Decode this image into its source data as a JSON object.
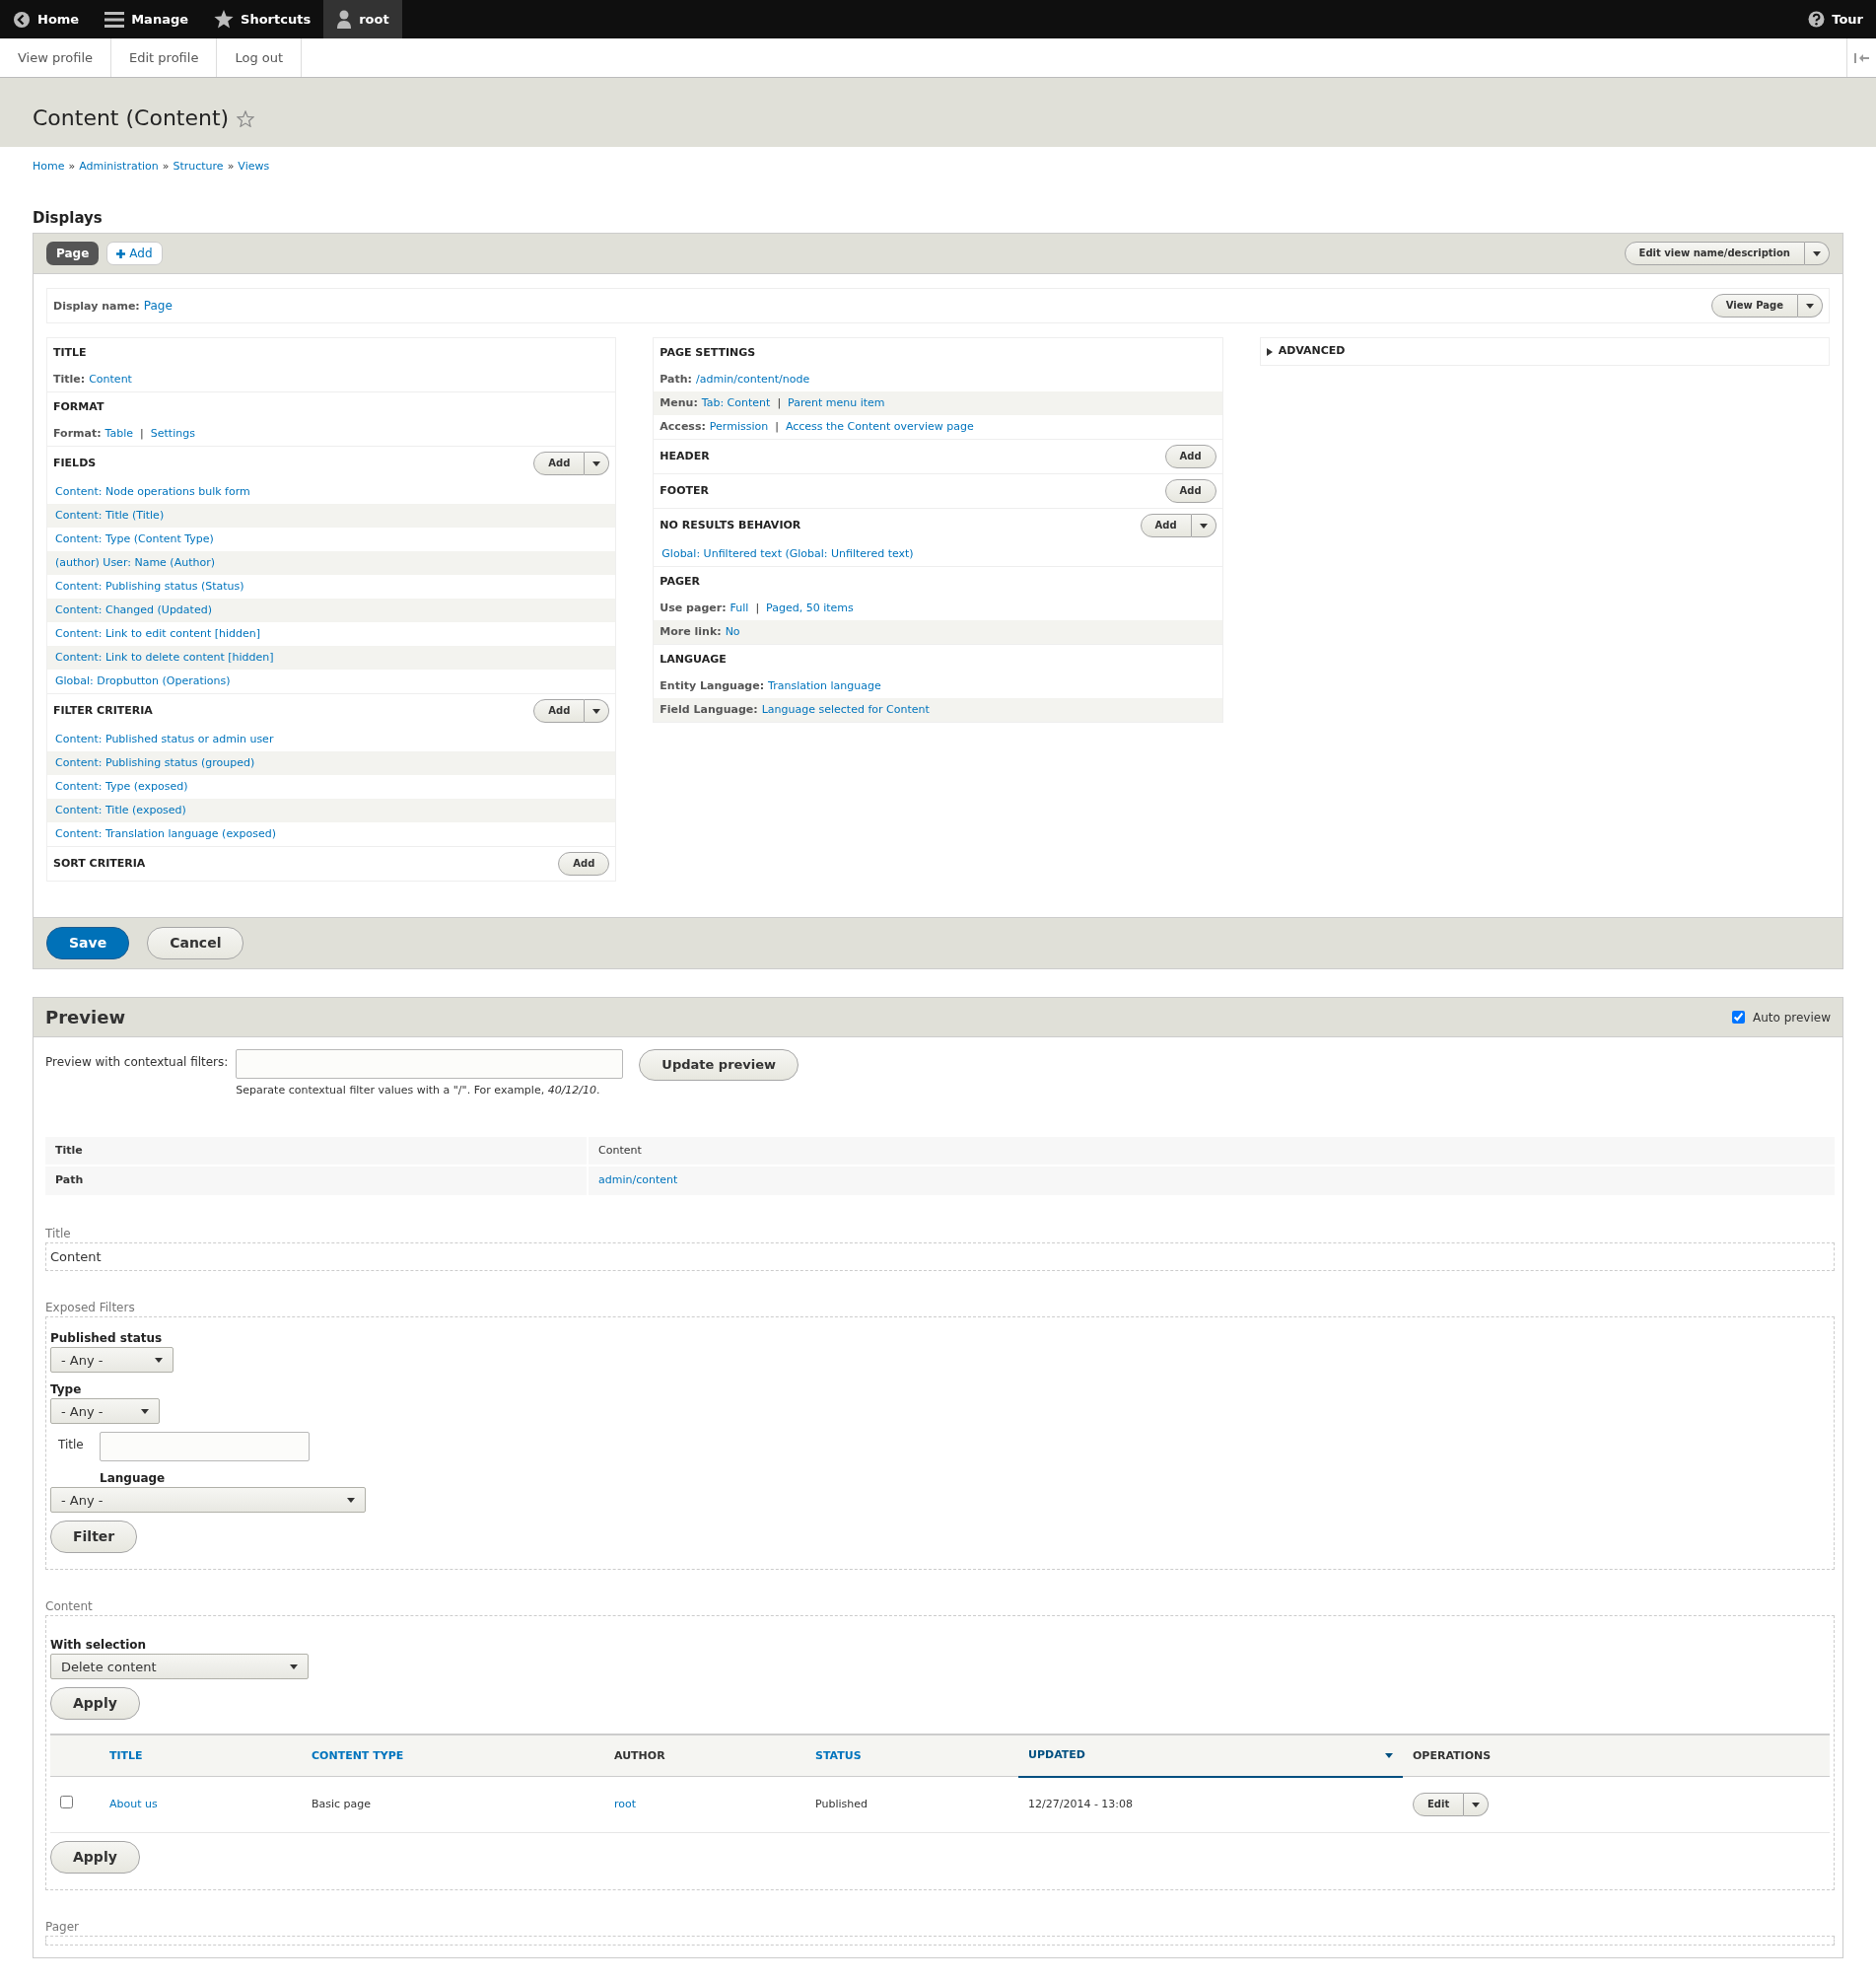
{
  "toolbar": {
    "items": [
      {
        "label": "Home",
        "selected": false
      },
      {
        "label": "Manage",
        "selected": false
      },
      {
        "label": "Shortcuts",
        "selected": false
      },
      {
        "label": "root",
        "selected": true
      }
    ],
    "tour": "Tour"
  },
  "user_tray": [
    "View profile",
    "Edit profile",
    "Log out"
  ],
  "page_title": "Content (Content)",
  "breadcrumb": {
    "separator": "»",
    "items": [
      "Home",
      "Administration",
      "Structure",
      "Views"
    ]
  },
  "displays": {
    "heading": "Displays",
    "tabs": [
      {
        "label": "Page",
        "selected": true
      }
    ],
    "add_label": "Add",
    "edit_button": "Edit view name/description"
  },
  "display_name": {
    "label": "Display name:",
    "value": "Page",
    "view_button": "View Page"
  },
  "columns": [
    [
      {
        "title": "TITLE",
        "rows": [
          {
            "kind": "setting",
            "label": "Title:",
            "links": [
              "Content"
            ]
          }
        ]
      },
      {
        "title": "FORMAT",
        "rows": [
          {
            "kind": "setting",
            "label": "Format:",
            "links": [
              "Table",
              "Settings"
            ],
            "separator": "|"
          }
        ]
      },
      {
        "title": "FIELDS",
        "add": {
          "label": "Add",
          "dropdown": true
        },
        "rows": [
          {
            "kind": "item",
            "text": "Content: Node operations bulk form"
          },
          {
            "kind": "item",
            "text": "Content: Title (Title)"
          },
          {
            "kind": "item",
            "text": "Content: Type (Content Type)"
          },
          {
            "kind": "item",
            "text": "(author) User: Name (Author)"
          },
          {
            "kind": "item",
            "text": "Content: Publishing status (Status)"
          },
          {
            "kind": "item",
            "text": "Content: Changed (Updated)"
          },
          {
            "kind": "item",
            "text": "Content: Link to edit content [hidden]"
          },
          {
            "kind": "item",
            "text": "Content: Link to delete content [hidden]"
          },
          {
            "kind": "item",
            "text": "Global: Dropbutton (Operations)"
          }
        ]
      },
      {
        "title": "FILTER CRITERIA",
        "add": {
          "label": "Add",
          "dropdown": true
        },
        "rows": [
          {
            "kind": "item",
            "text": "Content: Published status or admin user"
          },
          {
            "kind": "item",
            "text": "Content: Publishing status (grouped)"
          },
          {
            "kind": "item",
            "text": "Content: Type (exposed)"
          },
          {
            "kind": "item",
            "text": "Content: Title (exposed)"
          },
          {
            "kind": "item",
            "text": "Content: Translation language (exposed)"
          }
        ]
      },
      {
        "title": "SORT CRITERIA",
        "add": {
          "label": "Add",
          "dropdown": false
        }
      }
    ],
    [
      {
        "title": "PAGE SETTINGS",
        "rows": [
          {
            "kind": "setting",
            "label": "Path:",
            "links": [
              "/admin/content/node"
            ]
          },
          {
            "kind": "setting",
            "label": "Menu:",
            "links": [
              "Tab: Content",
              "Parent menu item"
            ],
            "separator": "|"
          },
          {
            "kind": "setting",
            "label": "Access:",
            "links": [
              "Permission",
              "Access the Content overview page"
            ],
            "separator": "|"
          }
        ]
      },
      {
        "title": "HEADER",
        "add": {
          "label": "Add",
          "dropdown": false
        }
      },
      {
        "title": "FOOTER",
        "add": {
          "label": "Add",
          "dropdown": false
        }
      },
      {
        "title": "NO RESULTS BEHAVIOR",
        "add": {
          "label": "Add",
          "dropdown": true
        },
        "rows": [
          {
            "kind": "item",
            "text": "Global: Unfiltered text (Global: Unfiltered text)"
          }
        ]
      },
      {
        "title": "PAGER",
        "rows": [
          {
            "kind": "setting",
            "label": "Use pager:",
            "links": [
              "Full",
              "Paged, 50 items"
            ],
            "separator": "|"
          },
          {
            "kind": "setting",
            "label": "More link:",
            "links": [
              "No"
            ]
          }
        ]
      },
      {
        "title": "LANGUAGE",
        "rows": [
          {
            "kind": "setting",
            "label": "Entity Language:",
            "links": [
              "Translation language"
            ]
          },
          {
            "kind": "setting",
            "label": "Field Language:",
            "links": [
              "Language selected for Content"
            ]
          }
        ]
      }
    ]
  ],
  "advanced": {
    "label": "ADVANCED",
    "expanded": false
  },
  "actions": [
    {
      "label": "Save",
      "kind": "primary"
    },
    {
      "label": "Cancel",
      "kind": "secondary"
    }
  ],
  "preview": {
    "title": "Preview",
    "auto_preview": {
      "label": "Auto preview",
      "checked": true
    },
    "contextual": {
      "label": "Preview with contextual filters:",
      "help": "Separate contextual filter values with a \"/\". For example, *40/12/10*."
    },
    "update_button": "Update preview",
    "info": [
      {
        "label": "Title",
        "value": "Content",
        "link": false
      },
      {
        "label": "Path",
        "value": "admin/content",
        "link": true
      }
    ],
    "title_section": {
      "legend": "Title",
      "text": "Content"
    },
    "exposed": {
      "legend": "Exposed Filters",
      "filters": [
        {
          "kind": "select",
          "label": "Published status",
          "value": "- Any -"
        },
        {
          "kind": "select",
          "label": "Type",
          "value": "- Any -"
        },
        {
          "kind": "text",
          "label": "Title"
        },
        {
          "kind": "select",
          "label": "Language",
          "value": "- Any -"
        }
      ],
      "button": "Filter"
    },
    "bulk": {
      "legend": "Content",
      "label": "With selection",
      "value": "Delete content",
      "apply": "Apply"
    },
    "table": {
      "columns": [
        {
          "label": "TITLE",
          "link": true,
          "sorted": false
        },
        {
          "label": "CONTENT TYPE",
          "link": true,
          "sorted": false
        },
        {
          "label": "AUTHOR",
          "link": false,
          "sorted": false
        },
        {
          "label": "STATUS",
          "link": true,
          "sorted": false
        },
        {
          "label": "UPDATED",
          "link": true,
          "sorted": true
        },
        {
          "label": "OPERATIONS",
          "link": false,
          "sorted": false
        }
      ],
      "rows": [
        {
          "checked": false,
          "title": "About us",
          "type": "Basic page",
          "author": "root",
          "status": "Published",
          "updated": "12/27/2014 - 13:08",
          "operation": "Edit"
        }
      ]
    },
    "apply_bottom": "Apply",
    "pager_legend": "Pager"
  }
}
